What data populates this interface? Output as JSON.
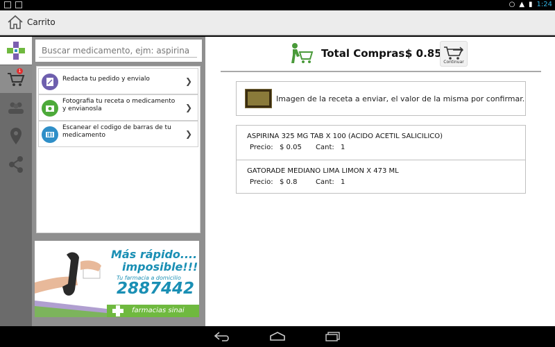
{
  "status_bar": {
    "time": "1:24"
  },
  "action_bar": {
    "title": "Carrito"
  },
  "rail": {
    "cart_badge": "1"
  },
  "search": {
    "placeholder": "Buscar medicamento, ejm: aspirina"
  },
  "options": [
    {
      "label": "Redacta tu pedido y envialo",
      "icon": "edit-icon",
      "color": "#6e5fae"
    },
    {
      "label": "Fotografia tu receta o medicamento y envianosla",
      "icon": "camera-icon",
      "color": "#4daa3a"
    },
    {
      "label": "Escanear el codigo de barras de tu medicamento",
      "icon": "barcode-icon",
      "color": "#2f8fc8"
    }
  ],
  "promo": {
    "line1": "Más rápido....",
    "line2": "imposible!!!",
    "line3": "Tu farmacia a domicilio",
    "phone": "2887442",
    "brand": "farmacias sinai"
  },
  "main": {
    "total_label": "Total Compras:",
    "total_amount": "$ 0.85",
    "continue_label": "Continuar",
    "recipe_text": "Imagen de la receta a enviar, el valor de la misma por confirmar.",
    "items": [
      {
        "name": "ASPIRINA 325 MG TAB X 100 (ACIDO ACETIL SALICILICO)",
        "price_label": "Precio:",
        "price": "$  0.05",
        "qty_label": "Cant:",
        "qty": "1"
      },
      {
        "name": "GATORADE MEDIANO LIMA LIMON X 473 ML",
        "price_label": "Precio:",
        "price": "$  0.8",
        "qty_label": "Cant:",
        "qty": "1"
      }
    ]
  },
  "colors": {
    "accent": "#33b5e5",
    "brand_green": "#6fb93f",
    "brand_blue": "#1a8fb4"
  }
}
